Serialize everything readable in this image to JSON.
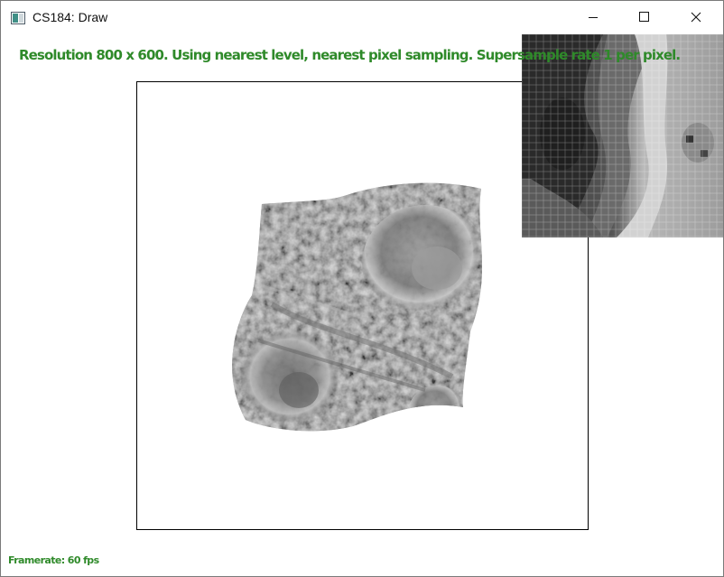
{
  "window": {
    "title": "CS184: Draw",
    "icon": "app-window-icon",
    "controls": {
      "minimize": "minimize-icon",
      "maximize": "maximize-icon",
      "close": "close-icon"
    }
  },
  "viewer": {
    "status": "Resolution 800 x 600. Using nearest level, nearest pixel sampling. Supersample rate 1 per pixel.",
    "framerate": "Framerate: 60 fps",
    "colors": {
      "status_text": "#2f8a2a",
      "frame_border": "#000000"
    }
  }
}
